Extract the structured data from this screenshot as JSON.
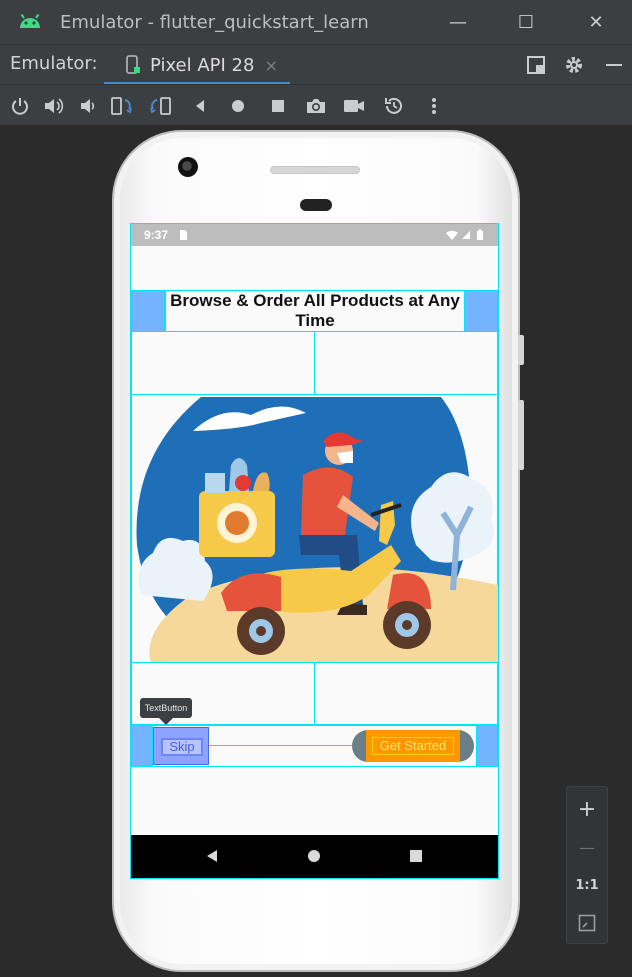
{
  "window": {
    "title": "Emulator - flutter_quickstart_learn",
    "minimize_label": "—",
    "maximize_label": "☐",
    "close_label": "✕"
  },
  "tabbar": {
    "label": "Emulator:",
    "tab_name": "Pixel API 28",
    "tab_close": "×"
  },
  "toolbar": {
    "icons": [
      "power-icon",
      "volume-up-icon",
      "volume-down-icon",
      "rotate-left-icon",
      "rotate-right-icon",
      "back-icon",
      "home-icon",
      "overview-icon",
      "screenshot-icon",
      "screen-record-icon",
      "snapshot-icon",
      "more-icon"
    ]
  },
  "phone": {
    "status_time": "9:37",
    "heading": "Browse & Order All Products at Any Time",
    "skip_label": "Skip",
    "get_started_label": "Get Started",
    "tooltip": "TextButton"
  },
  "zoom": {
    "zoom_in": "+",
    "zoom_out": "—",
    "one_to_one": "1:1"
  },
  "colors": {
    "ide_bg": "#2b2b2b",
    "ide_bar": "#3c3f41",
    "accent_tab": "#4a88c7",
    "guide": "#00e5ff",
    "padding_blue": "#74b4ff",
    "button_orange": "#ff9800",
    "skip_fill": "#8ea3ff"
  }
}
